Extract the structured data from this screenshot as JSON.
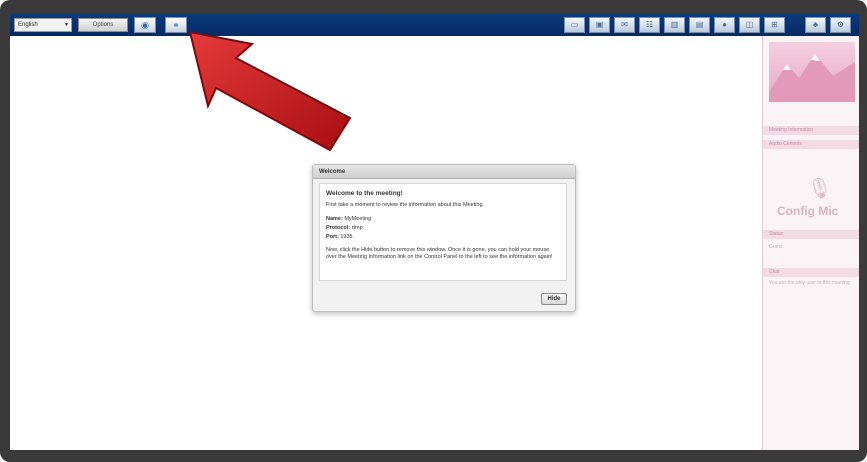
{
  "toolbar": {
    "language": "English",
    "options_label": "Options",
    "globe_icon": "globe-icon",
    "link_icon": "link-icon",
    "right_icons": [
      "monitor-icon",
      "window-icon",
      "chat-icon",
      "people-icon",
      "chart-icon",
      "files-icon",
      "record-icon",
      "layout-icon",
      "grid-icon",
      "users-icon",
      "gear-icon"
    ]
  },
  "dialog": {
    "title": "Welcome",
    "heading": "Welcome to the meeting!",
    "lead": "First take a moment to review the information about this Meeting.",
    "name_key": "Name:",
    "name_value": "MyMeeting",
    "protocol_key": "Protocol:",
    "protocol_value": "rtmp",
    "port_key": "Port:",
    "port_value": "1935",
    "note": "Now, click the Hide button to remove this window. Once it is gone, you can hold your mouse over the Meeting Information link on the Control Panel to the left to see the information again!",
    "hide_label": "Hide"
  },
  "sidepanel": {
    "meeting_info": "Meeting Information",
    "audio_controls": "Audio Controls",
    "config_mic": "Config Mic",
    "section2": "Status",
    "section2_text": "Guest",
    "section3": "Chat",
    "section3_text": "You are the only user in this meeting"
  },
  "colors": {
    "toolbar_bg": "#0b3a7e",
    "arrow": "#c8161b",
    "panel_pink": "#fbf4f6"
  }
}
